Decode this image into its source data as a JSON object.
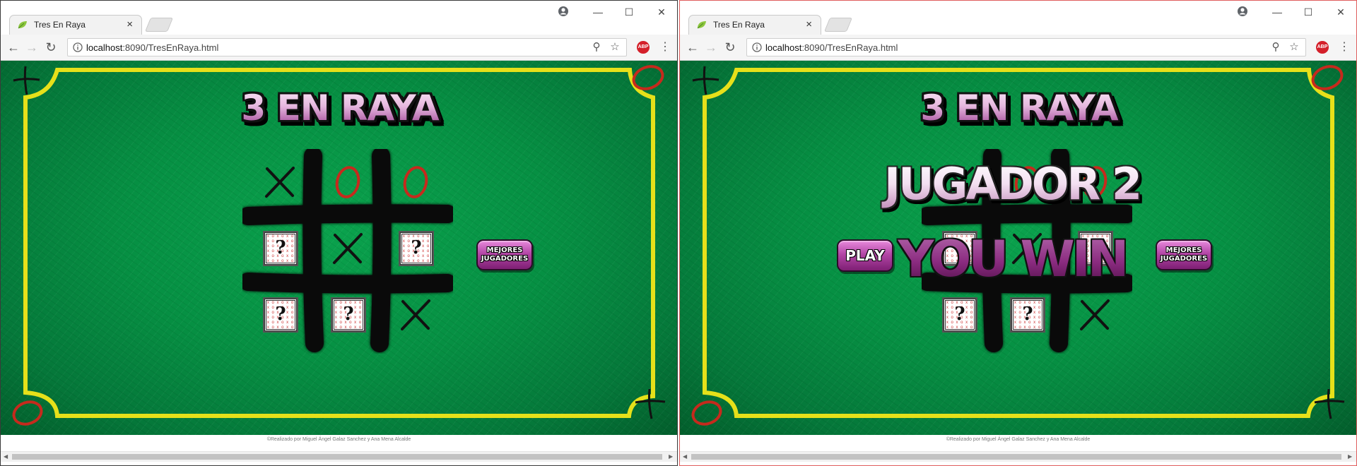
{
  "browser": {
    "tab_title": "Tres En Raya",
    "tab_close": "×",
    "url_host": "localhost",
    "url_rest": ":8090/TresEnRaya.html",
    "adblock_label": "ABP",
    "controls": {
      "minimize": "—",
      "maximize": "☐",
      "close": "✕"
    }
  },
  "game": {
    "title": "3 EN RAYA",
    "best_players_label_line1": "MEJORES",
    "best_players_label_line2": "JUGADORES",
    "footer": "©Realizado por Miguel Ángel Galaz Sanchez y Ana Mena Alcalde"
  },
  "left_board": [
    [
      "X",
      "O",
      "O"
    ],
    [
      "?",
      "X",
      "?"
    ],
    [
      "?",
      "?",
      "X"
    ]
  ],
  "right_board": [
    [
      "X",
      "O",
      "O"
    ],
    [
      "?",
      "X",
      "?"
    ],
    [
      "?",
      "?",
      "X"
    ]
  ],
  "right": {
    "play_label": "PLAY",
    "winner_line1": "JUGADOR 2",
    "winner_line2": "YOU WIN"
  },
  "colors": {
    "felt": "#069043",
    "frame": "#e6e01a",
    "x_mark": "#111111",
    "o_mark": "#c62a1d",
    "button_purple": "#9b3390"
  }
}
